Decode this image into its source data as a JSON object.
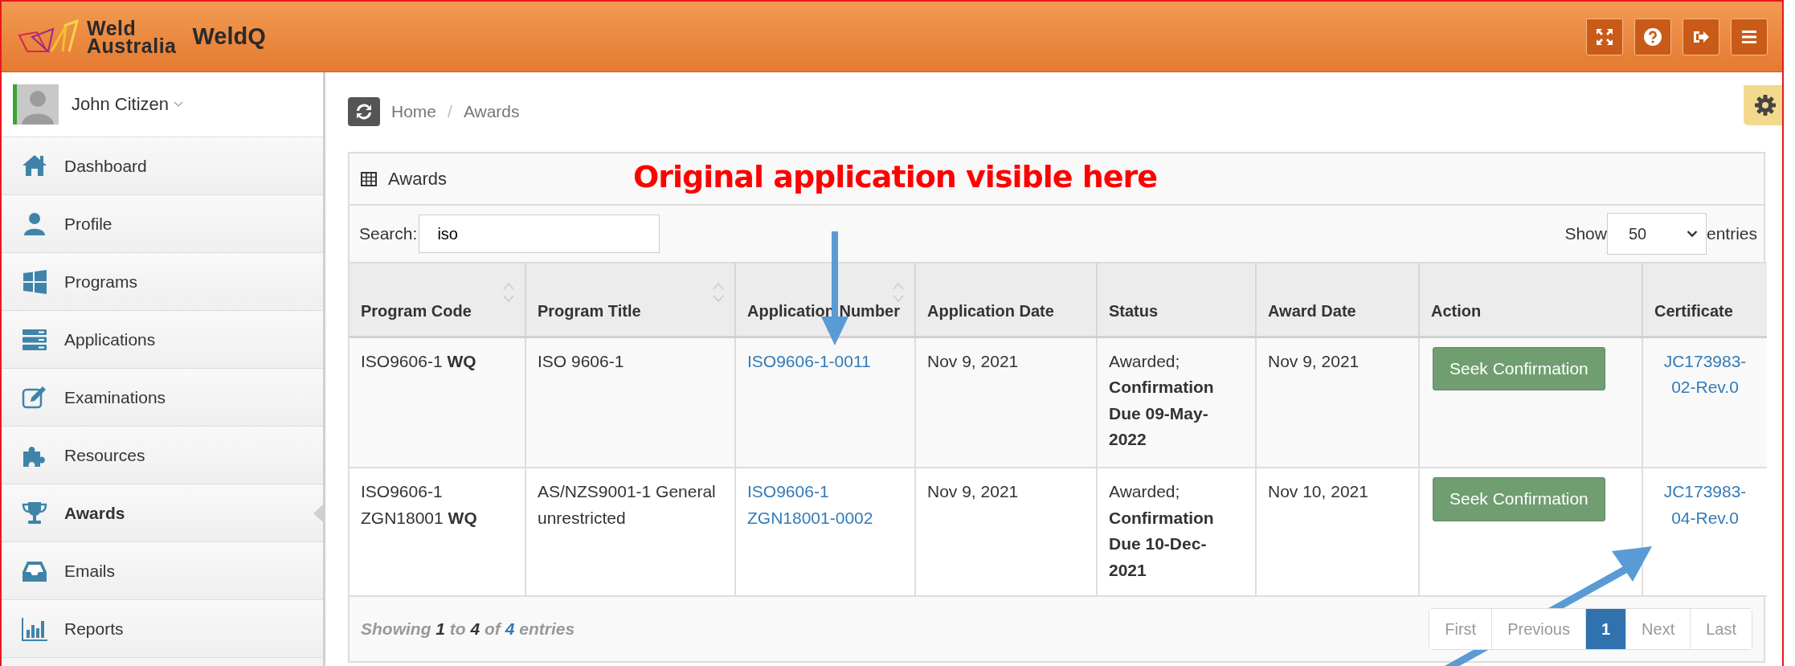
{
  "header": {
    "logo_lines": [
      "Weld",
      "Australia"
    ],
    "app_name": "WeldQ"
  },
  "sidebar": {
    "user": "John Citizen",
    "items": [
      {
        "label": "Dashboard",
        "selected": false
      },
      {
        "label": "Profile",
        "selected": false
      },
      {
        "label": "Programs",
        "selected": false
      },
      {
        "label": "Applications",
        "selected": false
      },
      {
        "label": "Examinations",
        "selected": false
      },
      {
        "label": "Resources",
        "selected": false
      },
      {
        "label": "Awards",
        "selected": true
      },
      {
        "label": "Emails",
        "selected": false
      },
      {
        "label": "Reports",
        "selected": false
      }
    ]
  },
  "breadcrumb": {
    "separator": "/",
    "items": [
      "Home",
      "Awards"
    ]
  },
  "panel": {
    "title": "Awards",
    "search": {
      "label": "Search:",
      "value": "iso"
    },
    "length": {
      "label_before": "Show",
      "value": "50",
      "label_after": "entries"
    },
    "columns": [
      {
        "label": "Program Code",
        "sortable": true
      },
      {
        "label": "Program Title",
        "sortable": true
      },
      {
        "label": "Application Number",
        "sortable": true
      },
      {
        "label": "Application Date",
        "sortable": false
      },
      {
        "label": "Status",
        "sortable": false
      },
      {
        "label": "Award Date",
        "sortable": false
      },
      {
        "label": "Action",
        "sortable": false
      },
      {
        "label": "Certificate",
        "sortable": false
      }
    ],
    "rows": [
      {
        "program_code": "ISO9606-1  **WQ**",
        "program_title": "ISO 9606-1",
        "application_number": "ISO9606-1-0011",
        "application_date": "Nov 9, 2021",
        "status": "Awarded; **Confirmation Due 09-May-2022**",
        "award_date": "Nov 9, 2021",
        "action": "Seek Confirmation",
        "certificate": "JC173983-02-Rev.0"
      },
      {
        "program_code": "ISO9606-1 ZGN18001  **WQ**",
        "program_title": "AS/NZS9001-1 General unrestricted",
        "application_number": "ISO9606-1 ZGN18001-0002",
        "application_date": "Nov 9, 2021",
        "status": "Awarded; **Confirmation Due 10-Dec-2021**",
        "award_date": "Nov 10, 2021",
        "action": "Seek Confirmation",
        "certificate": "JC173983-04-Rev.0"
      }
    ],
    "info": "Showing **1** to **4** of **4** entries",
    "pagination": [
      {
        "label": "First",
        "selected": false
      },
      {
        "label": "Previous",
        "selected": false
      },
      {
        "label": "1",
        "selected": true
      },
      {
        "label": "Next",
        "selected": false
      },
      {
        "label": "Last",
        "selected": false
      }
    ]
  },
  "annotation": {
    "text": "Original application visible here"
  }
}
